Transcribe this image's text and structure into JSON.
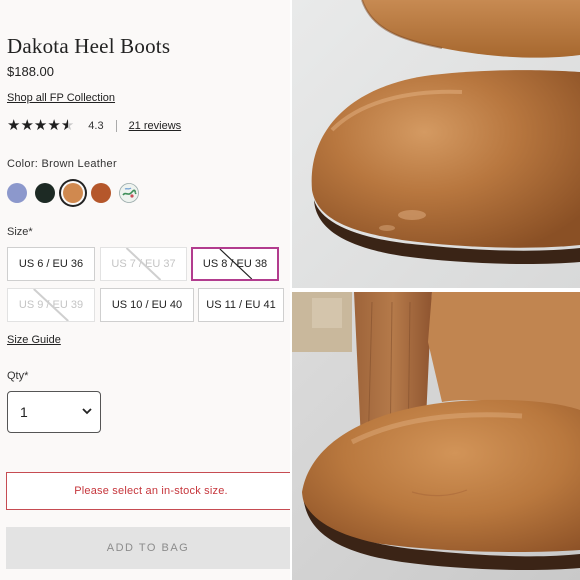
{
  "product": {
    "title": "Dakota Heel Boots",
    "price": "$188.00",
    "shop_link": "Shop all FP Collection",
    "rating": "4.3",
    "rating_value": 4.3,
    "reviews_link": "21 reviews"
  },
  "color": {
    "label": "Color: Brown Leather",
    "swatches": [
      {
        "name": "periwinkle",
        "hex": "#8c98cc"
      },
      {
        "name": "black",
        "hex": "#1d2a24"
      },
      {
        "name": "brown-leather",
        "hex": "#d0894f",
        "selected": true
      },
      {
        "name": "rust",
        "hex": "#b5572b"
      },
      {
        "name": "print",
        "hex": "#e6ede8"
      }
    ]
  },
  "size": {
    "label": "Size*",
    "options": [
      {
        "label": "US 6 / EU 36",
        "state": "available"
      },
      {
        "label": "US 7 / EU 37",
        "state": "out-of-stock"
      },
      {
        "label": "US 8 / EU 38",
        "state": "selected-out-of-stock"
      },
      {
        "label": "US 9 / EU 39",
        "state": "out-of-stock"
      },
      {
        "label": "US 10 / EU 40",
        "state": "available"
      },
      {
        "label": "US 11 / EU 41",
        "state": "available"
      }
    ],
    "guide": "Size Guide"
  },
  "qty": {
    "label": "Qty*",
    "value": "1"
  },
  "error": "Please select an in-stock size.",
  "add_to_bag": "ADD TO BAG",
  "colors": {
    "error": "#c6363c",
    "selected_border": "#b23c8e",
    "leather": "#b8773f"
  }
}
